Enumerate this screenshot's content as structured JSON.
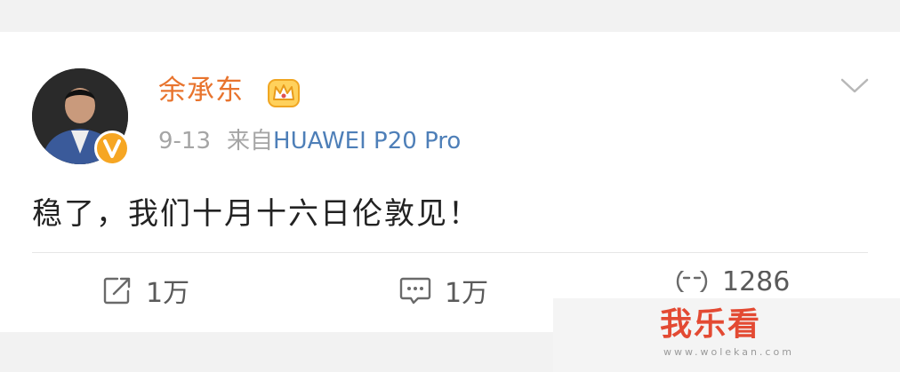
{
  "post": {
    "username": "余承东",
    "date": "9-13",
    "source_prefix": "来自",
    "source_device": "HUAWEI P20 Pro",
    "content": "稳了，我们十月十六日伦敦见！",
    "icons": {
      "avatar": "user-avatar",
      "verified": "verified-v-badge",
      "member": "crown-icon",
      "more": "chevron-down-icon",
      "repost": "repost-icon",
      "comment": "comment-icon",
      "like": "like-icon"
    },
    "actions": {
      "repost_count": "1万",
      "comment_count": "1万",
      "like_count": "1286"
    }
  },
  "watermark": {
    "title": "我乐看",
    "url": "www.wolekan.com"
  },
  "colors": {
    "username": "#e8742e",
    "source_link": "#4e7fb8",
    "meta": "#a5a5a5",
    "watermark": "#e34a33"
  }
}
